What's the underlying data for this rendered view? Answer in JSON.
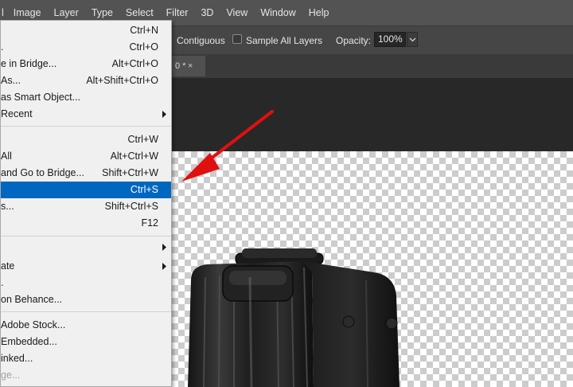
{
  "menubar": {
    "items": [
      "Image",
      "Layer",
      "Type",
      "Select",
      "Filter",
      "3D",
      "View",
      "Window",
      "Help"
    ]
  },
  "options_bar": {
    "contiguous_label": "Contiguous",
    "sample_all_layers_label": "Sample All Layers",
    "opacity_label": "Opacity:",
    "opacity_value": "100%"
  },
  "tab": {
    "label": "0 *",
    "close": "×"
  },
  "file_menu": {
    "items": [
      {
        "label": "",
        "shortcut": "Ctrl+N"
      },
      {
        "label": ".",
        "shortcut": "Ctrl+O"
      },
      {
        "label": "e in Bridge...",
        "shortcut": "Alt+Ctrl+O"
      },
      {
        "label": "As...",
        "shortcut": "Alt+Shift+Ctrl+O"
      },
      {
        "label": "as Smart Object...",
        "shortcut": ""
      },
      {
        "label": "Recent",
        "shortcut": ""
      },
      {
        "label": "",
        "shortcut": "Ctrl+W"
      },
      {
        "label": "All",
        "shortcut": "Alt+Ctrl+W"
      },
      {
        "label": "and Go to Bridge...",
        "shortcut": "Shift+Ctrl+W"
      },
      {
        "label": "",
        "shortcut": "Ctrl+S"
      },
      {
        "label": "s...",
        "shortcut": "Shift+Ctrl+S"
      },
      {
        "label": "",
        "shortcut": "F12"
      },
      {
        "label": "",
        "shortcut": ""
      },
      {
        "label": "ate",
        "shortcut": ""
      },
      {
        "label": ".",
        "shortcut": ""
      },
      {
        "label": "on Behance...",
        "shortcut": ""
      },
      {
        "label": "Adobe Stock...",
        "shortcut": ""
      },
      {
        "label": "Embedded...",
        "shortcut": ""
      },
      {
        "label": "inked...",
        "shortcut": ""
      },
      {
        "label": "ge...",
        "shortcut": ""
      }
    ]
  },
  "colors": {
    "highlight": "#0067c0",
    "arrow": "#e01010"
  },
  "icons": [
    "submenu-arrow-icon",
    "dropdown-chevron-icon",
    "close-icon",
    "red-arrow-icon"
  ]
}
